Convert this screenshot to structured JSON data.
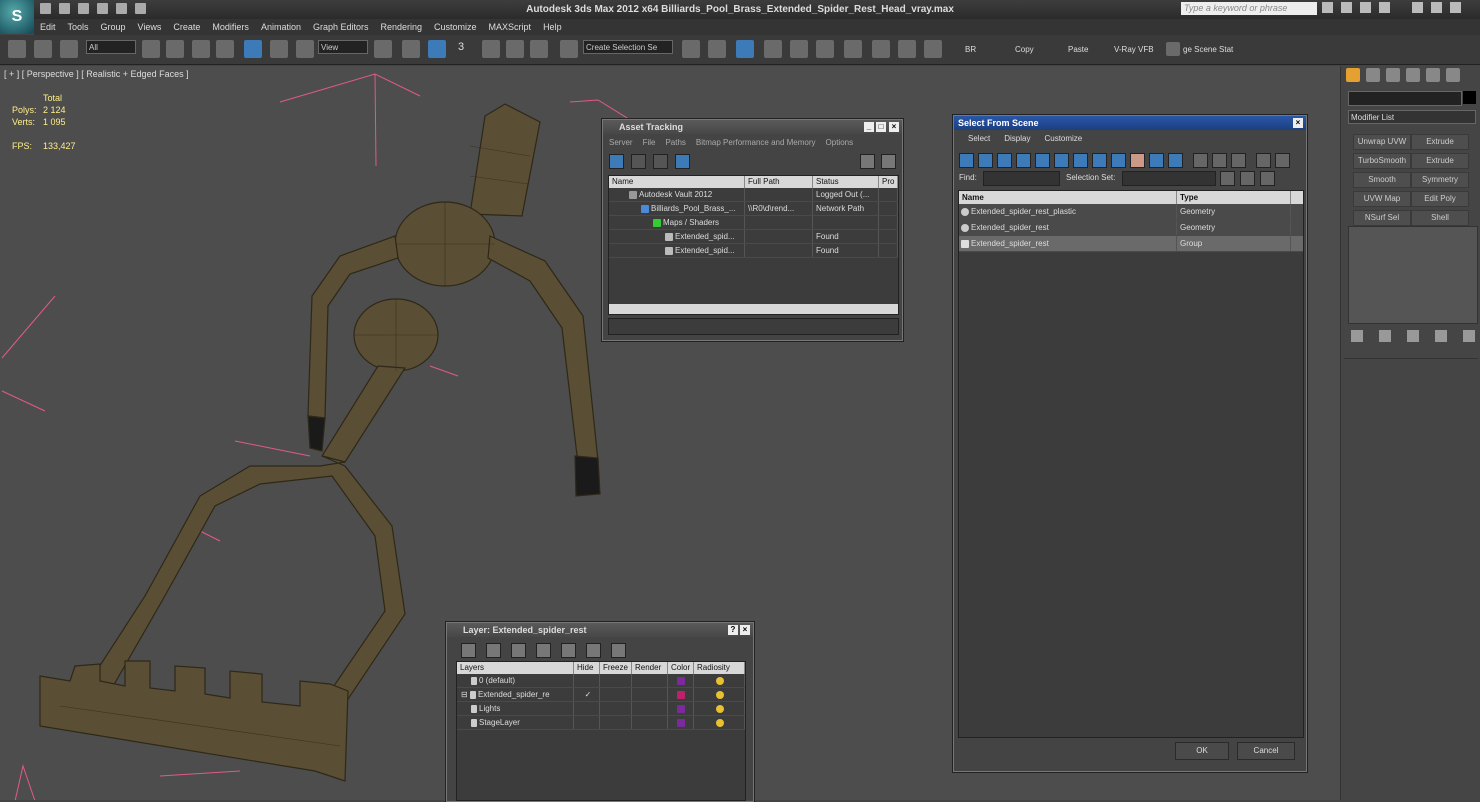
{
  "app": {
    "logo_text": "S",
    "title": "Autodesk 3ds Max  2012 x64     Billiards_Pool_Brass_Extended_Spider_Rest_Head_vray.max",
    "search_placeholder": "Type a keyword or phrase"
  },
  "menu": [
    "Edit",
    "Tools",
    "Group",
    "Views",
    "Create",
    "Modifiers",
    "Animation",
    "Graph Editors",
    "Rendering",
    "Customize",
    "MAXScript",
    "Help"
  ],
  "toolbar": {
    "selection_filter": "All",
    "ref_coord": "View",
    "snap_3": "3",
    "named_selection_placeholder": "Create Selection Se",
    "br_label": "BR",
    "copy_label": "Copy",
    "paste_label": "Paste",
    "vray_label": "V-Ray VFB",
    "stage_label": "ge Scene Stat"
  },
  "viewport": {
    "label": "[ + ] [ Perspective ] [ Realistic + Edged Faces ]",
    "stats": {
      "total_label": "Total",
      "polys_label": "Polys:",
      "polys_value": "2 124",
      "verts_label": "Verts:",
      "verts_value": "1 095",
      "fps_label": "FPS:",
      "fps_value": "133,427"
    }
  },
  "command_panel": {
    "modifier_list": "Modifier List",
    "buttons": [
      "Unwrap UVW",
      "Extrude",
      "TurboSmooth",
      "Extrude",
      "Smooth",
      "Symmetry",
      "UVW Map",
      "Edit Poly",
      "NSurf Sel",
      "Shell"
    ]
  },
  "asset_tracking": {
    "title": "Asset Tracking",
    "menu": [
      "Server",
      "File",
      "Paths",
      "Bitmap Performance and Memory",
      "Options"
    ],
    "columns": [
      "Name",
      "Full Path",
      "Status",
      "Pro"
    ],
    "rows": [
      {
        "name": "Autodesk Vault 2012",
        "path": "",
        "status": "Logged Out (..."
      },
      {
        "name": "Billiards_Pool_Brass_...",
        "path": "\\\\R0\\d\\rend...",
        "status": "Network Path"
      },
      {
        "name": "Maps / Shaders",
        "path": "",
        "status": ""
      },
      {
        "name": "Extended_spid...",
        "path": "",
        "status": "Found"
      },
      {
        "name": "Extended_spid...",
        "path": "",
        "status": "Found"
      }
    ]
  },
  "select_from_scene": {
    "title": "Select From Scene",
    "menu": [
      "Select",
      "Display",
      "Customize"
    ],
    "find_label": "Find:",
    "selection_set_label": "Selection Set:",
    "columns": [
      "Name",
      "Type"
    ],
    "rows": [
      {
        "name": "Extended_spider_rest_plastic",
        "type": "Geometry"
      },
      {
        "name": "Extended_spider_rest",
        "type": "Geometry"
      },
      {
        "name": "Extended_spider_rest",
        "type": "Group"
      }
    ],
    "ok": "OK",
    "cancel": "Cancel"
  },
  "layer_dialog": {
    "title": "Layer: Extended_spider_rest",
    "help": "?",
    "columns": [
      "Layers",
      "Hide",
      "Freeze",
      "Render",
      "Color",
      "Radiosity"
    ],
    "rows": [
      {
        "name": "0 (default)",
        "check": "",
        "color": "#7a2a9a"
      },
      {
        "name": "Extended_spider_re",
        "check": "✓",
        "color": "#c0206a"
      },
      {
        "name": "Lights",
        "check": "",
        "color": "#7a2a9a"
      },
      {
        "name": "StageLayer",
        "check": "",
        "color": "#7a2a9a"
      }
    ]
  },
  "colors": {
    "model_fill": "#5a4e34",
    "model_edge": "#2e2818",
    "bbox": "#e05a8a",
    "stats_text": "#ffee88"
  }
}
